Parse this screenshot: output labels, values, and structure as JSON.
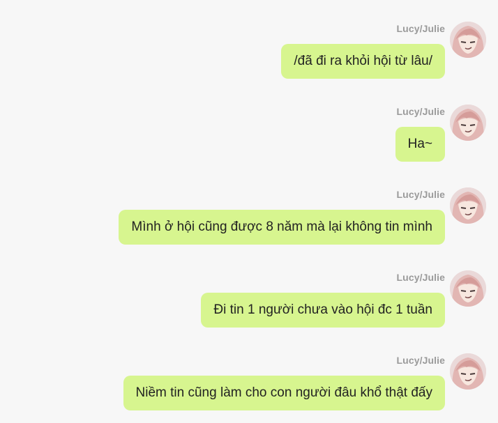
{
  "messages": [
    {
      "sender": "Lucy/Julie",
      "text": "/đã đi ra khỏi hội từ lâu/"
    },
    {
      "sender": "Lucy/Julie",
      "text": "Ha~"
    },
    {
      "sender": "Lucy/Julie",
      "text": "Mình ở hội cũng được 8 năm mà lại không tin mình"
    },
    {
      "sender": "Lucy/Julie",
      "text": "Đi tin 1 người chưa vào hội đc 1 tuần"
    },
    {
      "sender": "Lucy/Julie",
      "text": "Niềm tin cũng làm cho con người đâu khổ thật đấy"
    }
  ],
  "colors": {
    "background": "#f7f7f7",
    "bubble": "#d7f58f",
    "sender_name": "#9a9a9a",
    "message_text": "#222222",
    "avatar_hair": "#e2b6b3"
  },
  "icons": {
    "avatar": "anime-girl-avatar-icon"
  }
}
